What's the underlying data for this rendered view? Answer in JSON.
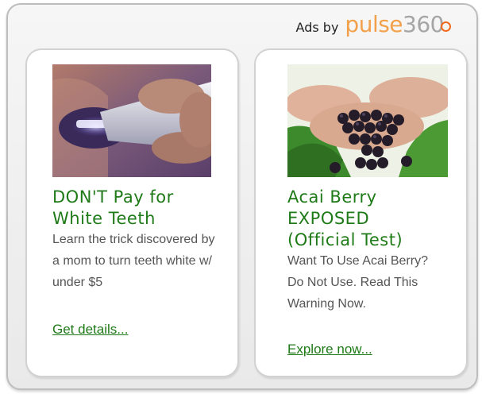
{
  "header": {
    "ads_by": "Ads by",
    "brand_part1": "pulse",
    "brand_part2": "360"
  },
  "ads": [
    {
      "title": "DON'T Pay for\nWhite Teeth",
      "description": "Learn the trick discovered by a mom to turn teeth white w/ under $5",
      "cta": "Get details..."
    },
    {
      "title": "Acai Berry\nEXPOSED\n(Official Test)",
      "description": "Want To Use Acai Berry? Do Not Use. Read This Warning Now.",
      "cta": "Explore now..."
    }
  ],
  "colors": {
    "title_green": "#1f7a18",
    "brand_orange": "#f3a04a",
    "brand_gray": "#a5a5a5"
  }
}
